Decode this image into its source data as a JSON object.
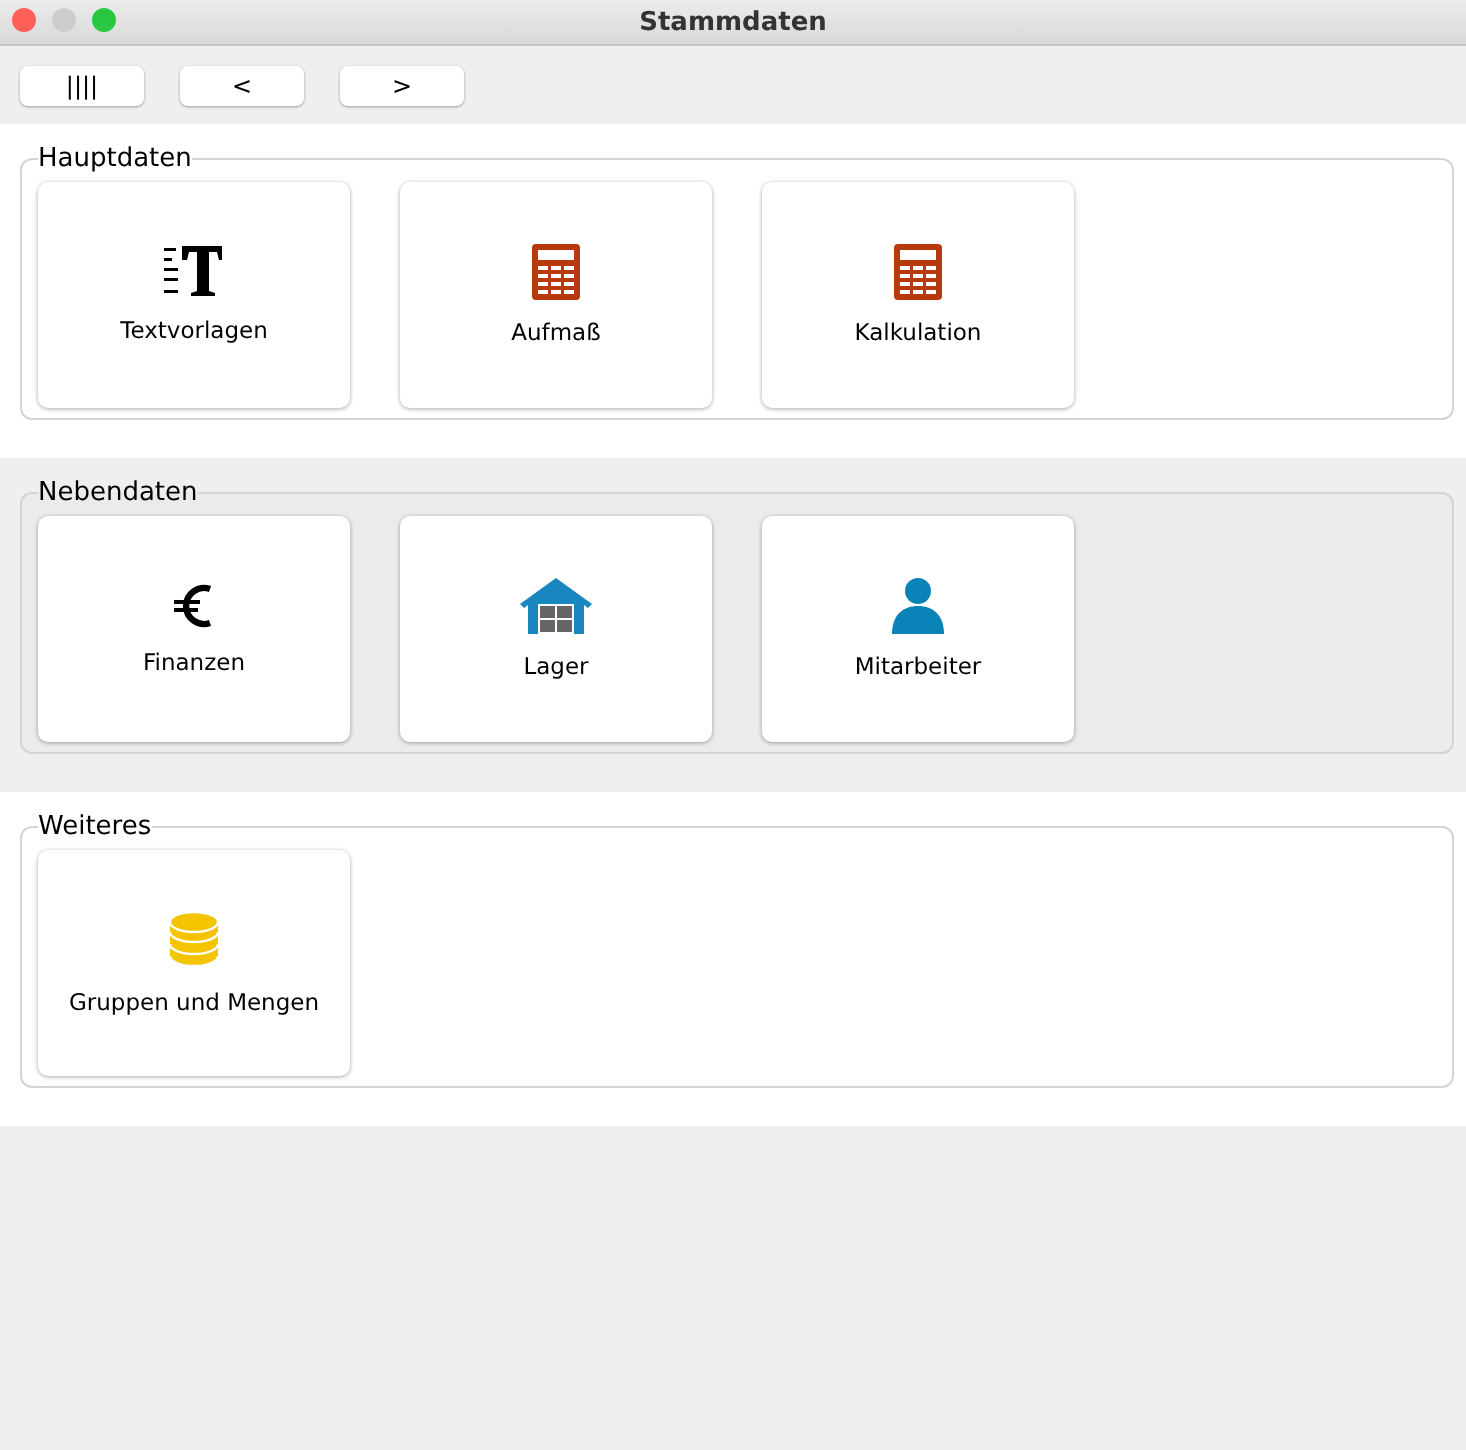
{
  "window": {
    "title": "Stammdaten"
  },
  "toolbar": [
    "||||",
    "<",
    ">"
  ],
  "sections": [
    {
      "title": "Hauptdaten",
      "highlighted": false,
      "tiles": [
        {
          "label": "Textvorlagen",
          "kind": "text"
        },
        {
          "label": "Aufmaß",
          "kind": "calculator"
        },
        {
          "label": "Kalkulation",
          "kind": "calculator"
        }
      ]
    },
    {
      "title": "Nebendaten",
      "highlighted": true,
      "tiles": [
        {
          "label": "Finanzen",
          "kind": "euro"
        },
        {
          "label": "Lager",
          "kind": "warehouse"
        },
        {
          "label": "Mitarbeiter",
          "kind": "person"
        }
      ]
    },
    {
      "title": "Weiteres",
      "highlighted": false,
      "tiles": [
        {
          "label": "Gruppen und Mengen",
          "kind": "coins"
        }
      ]
    }
  ]
}
